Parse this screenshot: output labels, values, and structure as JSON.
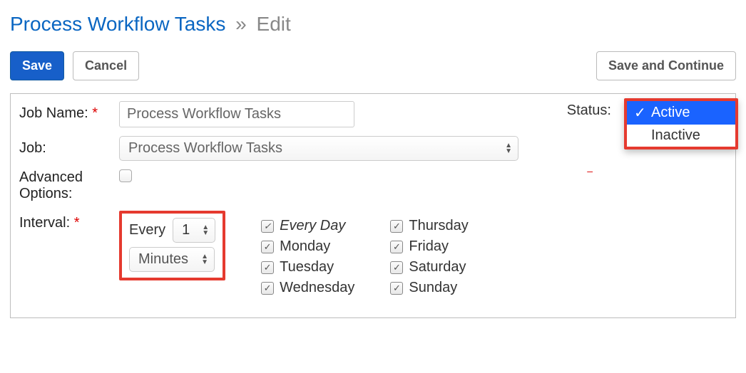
{
  "colors": {
    "primary": "#175fc9",
    "highlight_border": "#e53a2f"
  },
  "breadcrumb": {
    "root": "Process Workflow Tasks",
    "current": "Edit"
  },
  "buttons": {
    "save": "Save",
    "cancel": "Cancel",
    "save_continue": "Save and Continue"
  },
  "labels": {
    "job_name": "Job Name:",
    "job": "Job:",
    "advanced_options": "Advanced Options:",
    "interval": "Interval:",
    "status": "Status:",
    "required_mark": "*"
  },
  "form": {
    "job_name_value": "Process Workflow Tasks",
    "job_value": "Process Workflow Tasks",
    "advanced_options_checked": false
  },
  "interval": {
    "every_label": "Every",
    "value": "1",
    "unit": "Minutes",
    "days_col1": [
      {
        "label": "Every Day",
        "checked": true,
        "em": true
      },
      {
        "label": "Monday",
        "checked": true
      },
      {
        "label": "Tuesday",
        "checked": true
      },
      {
        "label": "Wednesday",
        "checked": true
      }
    ],
    "days_col2": [
      {
        "label": "Thursday",
        "checked": true
      },
      {
        "label": "Friday",
        "checked": true
      },
      {
        "label": "Saturday",
        "checked": true
      },
      {
        "label": "Sunday",
        "checked": true
      }
    ]
  },
  "status": {
    "options": [
      {
        "label": "Active",
        "selected": true
      },
      {
        "label": "Inactive",
        "selected": false
      }
    ]
  }
}
